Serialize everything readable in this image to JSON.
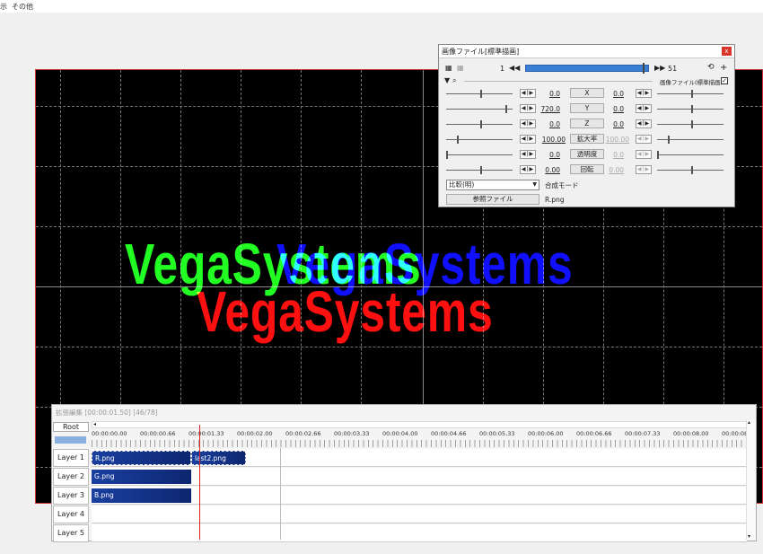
{
  "menu": {
    "item_left": "示",
    "item_other": "その他"
  },
  "preview": {
    "texts": [
      {
        "text": "VegaSystems",
        "color": "#22ff22"
      },
      {
        "text": "VegaSystems",
        "color": "#1010ff"
      },
      {
        "text": "VegaSystems",
        "color": "#ff1010"
      }
    ]
  },
  "dialog": {
    "title": "画像ファイル[標準描画]",
    "close": "x",
    "frame_start": "1",
    "frame_end": "51",
    "prev_icon": "◀◀",
    "next_icon": "▶▶",
    "filter_label": "画像ファイル(標準描画)",
    "params": [
      {
        "name": "X",
        "left": "0.0",
        "right": "0.0",
        "right_dim": false
      },
      {
        "name": "Y",
        "left": "720.0",
        "right": "0.0",
        "right_dim": false
      },
      {
        "name": "Z",
        "left": "0.0",
        "right": "0.0",
        "right_dim": false
      },
      {
        "name": "拡大率",
        "left": "100.00",
        "right": "100.00",
        "right_dim": true
      },
      {
        "name": "透明度",
        "left": "0.0",
        "right": "0.0",
        "right_dim": true
      },
      {
        "name": "回転",
        "left": "0.00",
        "right": "0.00",
        "right_dim": true
      }
    ],
    "stepper_label": "◀|▶",
    "blend_value": "比較(明)",
    "blend_label": "合成モード",
    "ref_button": "参照ファイル",
    "file_name": "R.png"
  },
  "timeline": {
    "title": "拡張編集 [00:00:01.50] [46/78]",
    "root": "Root",
    "ruler_labels": [
      "00:00:00.00",
      "00:00:00.66",
      "00:00:01.33",
      "00:00:02.00",
      "00:00:02.66",
      "00:00:03.33",
      "00:00:04.00",
      "00:00:04.66",
      "00:00:05.33",
      "00:00:06.00",
      "00:00:06.66",
      "00:00:07.33",
      "00:00:08.00",
      "00:00:08"
    ],
    "layers": [
      {
        "label": "Layer 1",
        "clips": [
          {
            "text": "R.png",
            "start": 0,
            "end": 1.37
          },
          {
            "text": "last2.png",
            "start": 1.37,
            "end": 2.12
          }
        ]
      },
      {
        "label": "Layer 2",
        "clips": [
          {
            "text": "G.png",
            "start": 0,
            "end": 1.37
          }
        ]
      },
      {
        "label": "Layer 3",
        "clips": [
          {
            "text": "B.png",
            "start": 0,
            "end": 1.37
          }
        ]
      },
      {
        "label": "Layer 4",
        "clips": []
      },
      {
        "label": "Layer 5",
        "clips": []
      }
    ]
  }
}
